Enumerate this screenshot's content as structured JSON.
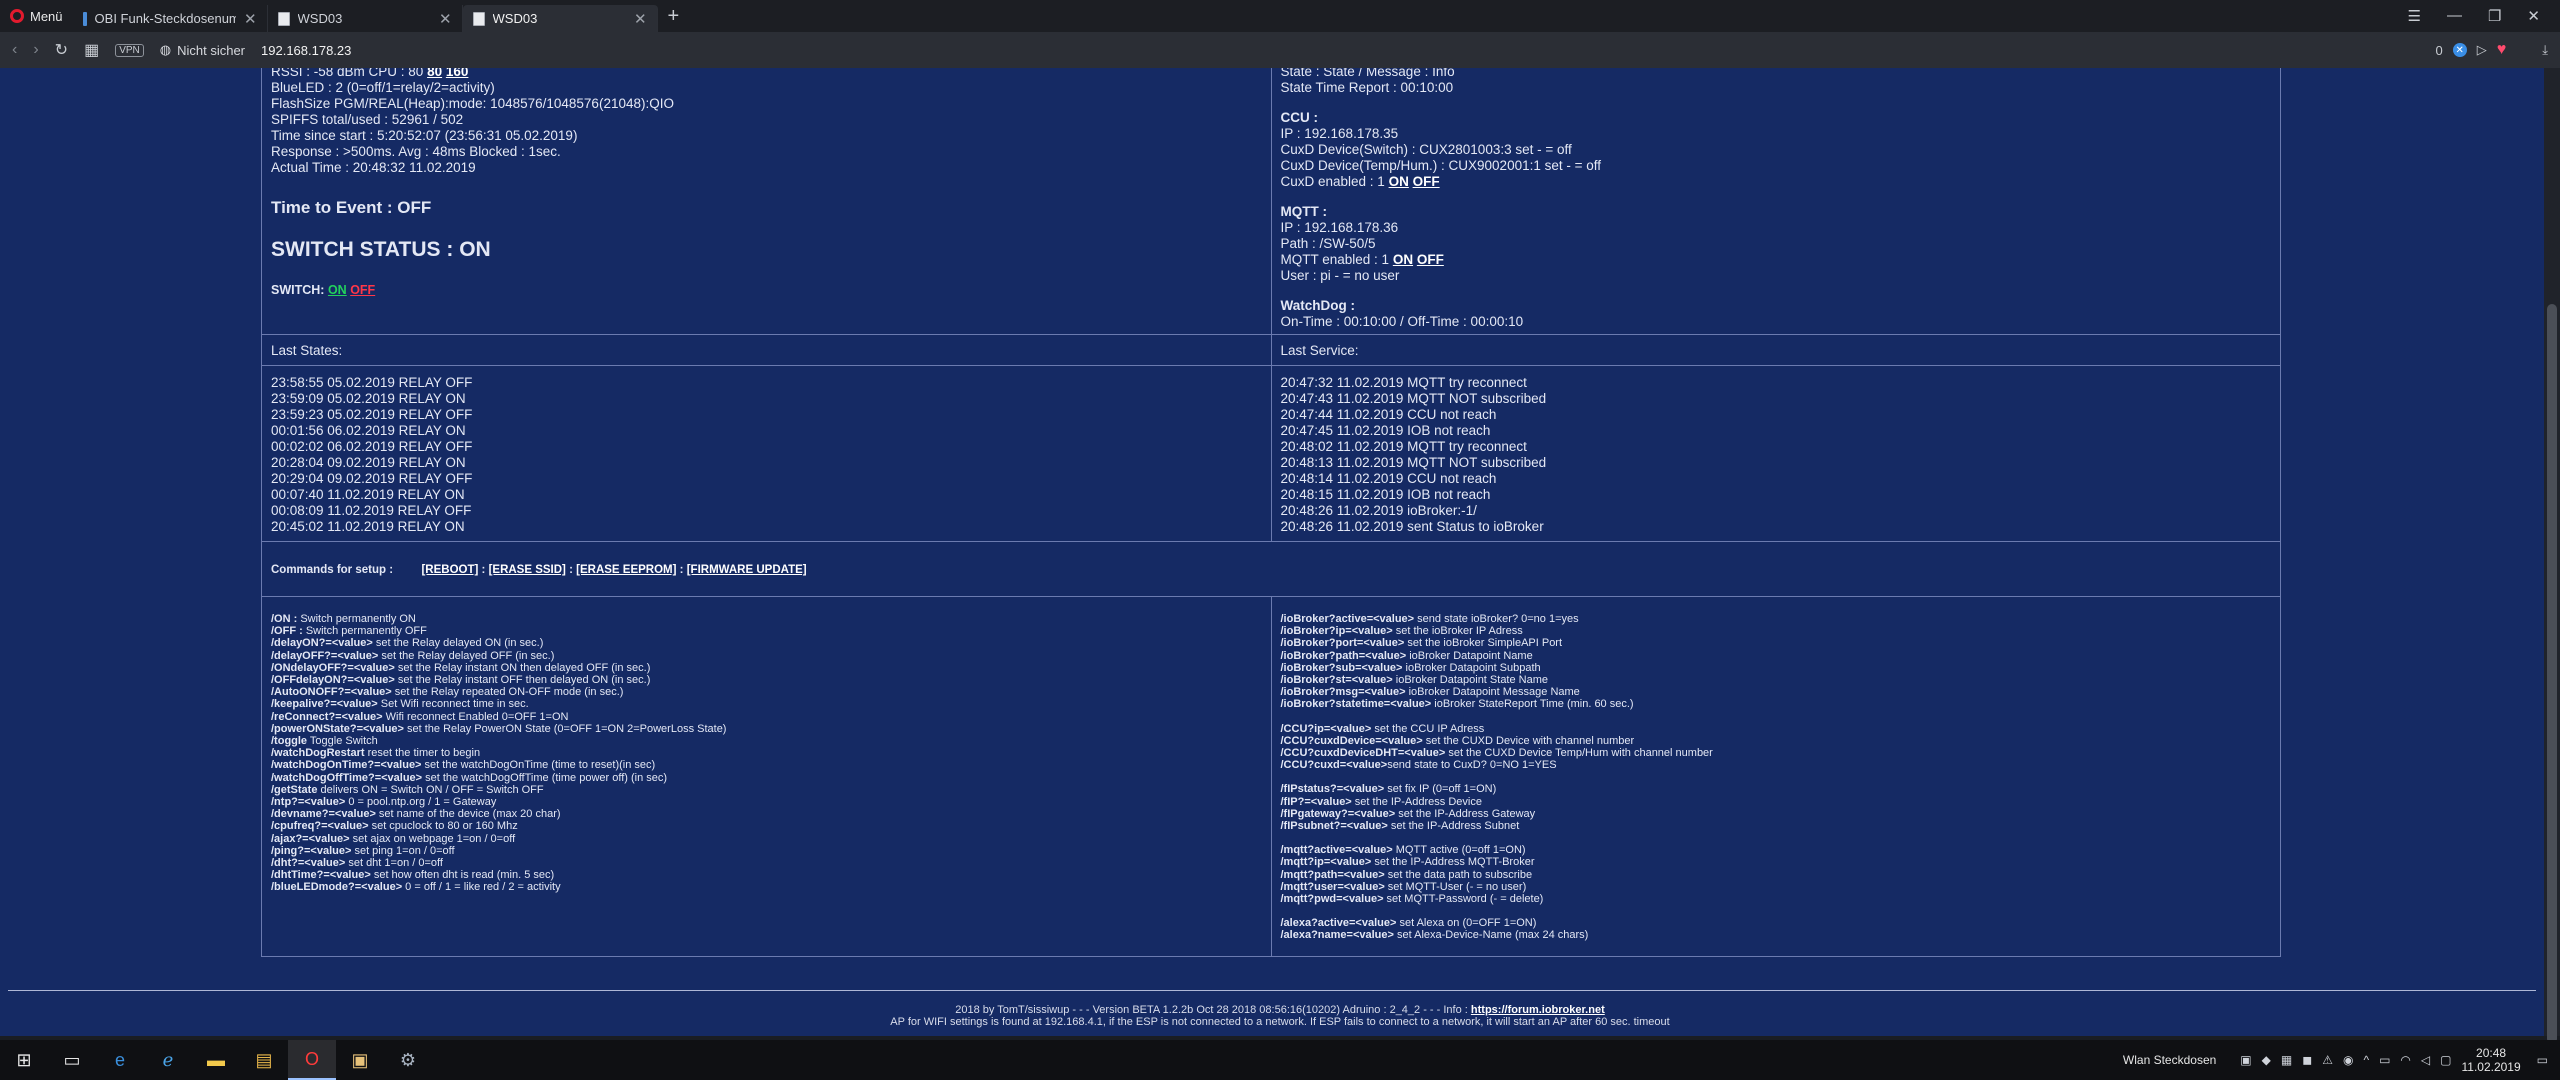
{
  "browser": {
    "menu_label": "Menü",
    "tabs": [
      {
        "title": "OBI Funk-Steckdosenumb",
        "active": false
      },
      {
        "title": "WSD03",
        "active": false
      },
      {
        "title": "WSD03",
        "active": true
      }
    ],
    "vpn_label": "VPN",
    "security_label": "Nicht sicher",
    "url": "192.168.178.23",
    "blocked_count": "0"
  },
  "left_top": {
    "lines": [
      "RSSI : -58 dBm CPU : 80",
      "BlueLED : 2 (0=off/1=relay/2=activity)",
      "FlashSize PGM/REAL(Heap):mode: 1048576/1048576(21048):QIO",
      "SPIFFS total/used : 52961 / 502",
      "Time since start : 5:20:52:07 (23:56:31 05.02.2019)",
      "Response : >500ms. Avg : 48ms Blocked : 1sec.",
      "Actual Time : 20:48:32 11.02.2019"
    ],
    "cpu_opt_80": "80",
    "cpu_opt_160": "160",
    "time_to_event": "Time to Event : OFF",
    "switch_status": "SWITCH STATUS : ON",
    "switch_label": "SWITCH:",
    "switch_on": "ON",
    "switch_off": "OFF"
  },
  "right_top": {
    "state_lines": [
      "State : State / Message : Info",
      "State Time Report : 00:10:00"
    ],
    "ccu_title": "CCU :",
    "ccu_lines": [
      "IP : 192.168.178.35",
      "CuxD Device(Switch) : CUX2801003:3 set - = off",
      "CuxD Device(Temp/Hum.) : CUX9002001:1 set - = off"
    ],
    "ccu_enabled": "CuxD enabled : 1",
    "mqtt_title": "MQTT :",
    "mqtt_lines": [
      "IP : 192.168.178.36",
      "Path : /SW-50/5"
    ],
    "mqtt_enabled": "MQTT enabled : 1",
    "mqtt_user": "User : pi - = no user",
    "watchdog_title": "WatchDog :",
    "watchdog_line": "On-Time : 00:10:00 / Off-Time : 00:00:10",
    "on_label": "ON",
    "off_label": "OFF"
  },
  "last_states": {
    "label": "Last States:",
    "items": [
      "23:58:55 05.02.2019 RELAY OFF",
      "23:59:09 05.02.2019 RELAY ON",
      "23:59:23 05.02.2019 RELAY OFF",
      "00:01:56 06.02.2019 RELAY ON",
      "00:02:02 06.02.2019 RELAY OFF",
      "20:28:04 09.02.2019 RELAY ON",
      "20:29:04 09.02.2019 RELAY OFF",
      "00:07:40 11.02.2019 RELAY ON",
      "00:08:09 11.02.2019 RELAY OFF",
      "20:45:02 11.02.2019 RELAY ON"
    ]
  },
  "last_service": {
    "label": "Last Service:",
    "items": [
      "20:47:32 11.02.2019 MQTT try reconnect",
      "20:47:43 11.02.2019 MQTT NOT subscribed",
      "20:47:44 11.02.2019 CCU not reach",
      "20:47:45 11.02.2019 IOB not reach",
      "20:48:02 11.02.2019 MQTT try reconnect",
      "20:48:13 11.02.2019 MQTT NOT subscribed",
      "20:48:14 11.02.2019 CCU not reach",
      "20:48:15 11.02.2019 IOB not reach",
      "20:48:26 11.02.2019 ioBroker:-1/",
      "20:48:26 11.02.2019 sent Status to ioBroker"
    ]
  },
  "commands": {
    "label": "Commands for setup :",
    "reboot": "[REBOOT]",
    "erase_ssid": "[ERASE SSID]",
    "erase_eeprom": "[ERASE EEPROM]",
    "firmware": "[FIRMWARE UPDATE]",
    "sep": ":"
  },
  "help_left": [
    {
      "cmd": "/ON :",
      "desc": " Switch permanently ON"
    },
    {
      "cmd": "/OFF :",
      "desc": " Switch permanently OFF"
    },
    {
      "cmd": "/delayON?=<value>",
      "desc": " set the Relay delayed ON (in sec.)"
    },
    {
      "cmd": "/delayOFF?=<value>",
      "desc": " set the Relay delayed OFF (in sec.)"
    },
    {
      "cmd": "/ONdelayOFF?=<value>",
      "desc": " set the Relay instant ON then delayed OFF (in sec.)"
    },
    {
      "cmd": "/OFFdelayON?=<value>",
      "desc": " set the Relay instant OFF then delayed ON (in sec.)"
    },
    {
      "cmd": "/AutoONOFF?=<value>",
      "desc": " set the Relay repeated ON-OFF mode (in sec.)"
    },
    {
      "cmd": "/keepalive?=<value>",
      "desc": " Set Wifi reconnect time in sec."
    },
    {
      "cmd": "/reConnect?=<value>",
      "desc": " Wifi reconnect Enabled 0=OFF 1=ON"
    },
    {
      "cmd": "/powerONState?=<value>",
      "desc": " set the Relay PowerON State (0=OFF 1=ON 2=PowerLoss State)"
    },
    {
      "cmd": "/toggle",
      "desc": " Toggle Switch"
    },
    {
      "cmd": "/watchDogRestart",
      "desc": " reset the timer to begin"
    },
    {
      "cmd": "/watchDogOnTime?=<value>",
      "desc": " set the watchDogOnTime (time to reset)(in sec)"
    },
    {
      "cmd": "/watchDogOffTime?=<value>",
      "desc": " set the watchDogOffTime (time power off) (in sec)"
    },
    {
      "cmd": "/getState",
      "desc": " delivers ON = Switch ON / OFF = Switch OFF"
    },
    {
      "cmd": "/ntp?=<value>",
      "desc": " 0 = pool.ntp.org / 1 = Gateway"
    },
    {
      "cmd": "/devname?=<value>",
      "desc": " set name of the device (max 20 char)"
    },
    {
      "cmd": "/cpufreq?=<value>",
      "desc": " set cpuclock to 80 or 160 Mhz"
    },
    {
      "cmd": "/ajax?=<value>",
      "desc": " set ajax on webpage 1=on / 0=off"
    },
    {
      "cmd": "/ping?=<value>",
      "desc": " set ping 1=on / 0=off"
    },
    {
      "cmd": "/dht?=<value>",
      "desc": " set dht 1=on / 0=off"
    },
    {
      "cmd": "/dhtTime?=<value>",
      "desc": " set how often dht is read (min. 5 sec)"
    },
    {
      "cmd": "/blueLEDmode?=<value>",
      "desc": " 0 = off / 1 = like red / 2 = activity"
    }
  ],
  "help_right": [
    [
      {
        "cmd": "/ioBroker?active=<value>",
        "desc": " send state ioBroker? 0=no 1=yes"
      },
      {
        "cmd": "/ioBroker?ip=<value>",
        "desc": " set the ioBroker IP Adress"
      },
      {
        "cmd": "/ioBroker?port=<value>",
        "desc": " set the ioBroker SimpleAPI Port"
      },
      {
        "cmd": "/ioBroker?path=<value>",
        "desc": " ioBroker Datapoint Name"
      },
      {
        "cmd": "/ioBroker?sub=<value>",
        "desc": " ioBroker Datapoint Subpath"
      },
      {
        "cmd": "/ioBroker?st=<value>",
        "desc": " ioBroker Datapoint State Name"
      },
      {
        "cmd": "/ioBroker?msg=<value>",
        "desc": " ioBroker Datapoint Message Name"
      },
      {
        "cmd": "/ioBroker?statetime=<value>",
        "desc": " ioBroker StateReport Time (min. 60 sec.)"
      }
    ],
    [
      {
        "cmd": "/CCU?ip=<value>",
        "desc": " set the CCU IP Adress"
      },
      {
        "cmd": "/CCU?cuxdDevice=<value>",
        "desc": " set the CUXD Device with channel number"
      },
      {
        "cmd": "/CCU?cuxdDeviceDHT=<value>",
        "desc": " set the CUXD Device Temp/Hum with channel number"
      },
      {
        "cmd": "/CCU?cuxd=<value>",
        "desc": "send state to CuxD? 0=NO 1=YES"
      }
    ],
    [
      {
        "cmd": "/fIPstatus?=<value>",
        "desc": " set fix IP (0=off 1=ON)"
      },
      {
        "cmd": "/fIP?=<value>",
        "desc": " set the IP-Address Device"
      },
      {
        "cmd": "/fIPgateway?=<value>",
        "desc": " set the IP-Address Gateway"
      },
      {
        "cmd": "/fIPsubnet?=<value>",
        "desc": " set the IP-Address Subnet"
      }
    ],
    [
      {
        "cmd": "/mqtt?active=<value>",
        "desc": " MQTT active (0=off 1=ON)"
      },
      {
        "cmd": "/mqtt?ip=<value>",
        "desc": " set the IP-Address MQTT-Broker"
      },
      {
        "cmd": "/mqtt?path=<value>",
        "desc": " set the data path to subscribe"
      },
      {
        "cmd": "/mqtt?user=<value>",
        "desc": " set MQTT-User (- = no user)"
      },
      {
        "cmd": "/mqtt?pwd=<value>",
        "desc": " set MQTT-Password (- = delete)"
      }
    ],
    [
      {
        "cmd": "/alexa?active=<value>",
        "desc": " set Alexa on (0=OFF 1=ON)"
      },
      {
        "cmd": "/alexa?name=<value>",
        "desc": " set Alexa-Device-Name (max 24 chars)"
      }
    ]
  ],
  "footer": {
    "line1": "2018 by TomT/sissiwup - - - Version BETA 1.2.2b Oct 28 2018 08:56:16(10202) Adruino : 2_4_2 - - - Info :",
    "link": "https://forum.iobroker.net",
    "line2": "AP for WIFI settings is found at 192.168.4.1, if the ESP is not connected to a network. If ESP fails to connect to a network, it will start an AP after 60 sec. timeout"
  },
  "taskbar": {
    "network_label": "Wlan Steckdosen",
    "time": "20:48",
    "date": "11.02.2019"
  },
  "colors": {
    "page_bg": "#152a64",
    "on_green": "#22d25c",
    "off_red": "#ff3648"
  }
}
